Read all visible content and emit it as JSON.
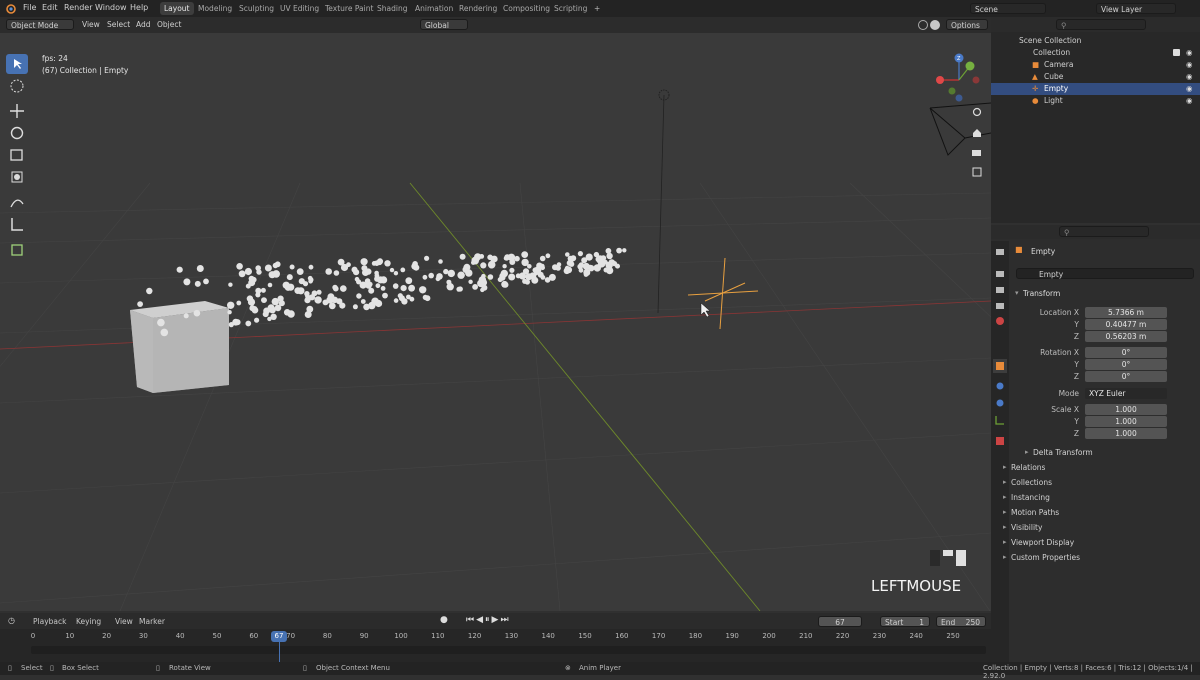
{
  "menu": [
    "File",
    "Edit",
    "Render",
    "Window",
    "Help"
  ],
  "workspaces": [
    "Layout",
    "Modeling",
    "Sculpting",
    "UV Editing",
    "Texture Paint",
    "Shading",
    "Animation",
    "Rendering",
    "Compositing",
    "Scripting"
  ],
  "active_workspace": "Layout",
  "scene_name": "Scene",
  "view_layer": "View Layer",
  "viewport_header": {
    "mode": "Object Mode",
    "items": [
      "View",
      "Select",
      "Add",
      "Object"
    ],
    "orientation": "Global",
    "options": "Options"
  },
  "viewport_info": {
    "fps": "fps: 24",
    "collection": "(67) Collection | Empty"
  },
  "keystroke": "LEFTMOUSE",
  "outliner": {
    "rows": [
      {
        "label": "Scene Collection",
        "indent": 0
      },
      {
        "label": "Collection",
        "indent": 1
      },
      {
        "label": "Camera",
        "indent": 2
      },
      {
        "label": "Cube",
        "indent": 2
      },
      {
        "label": "Empty",
        "indent": 2
      },
      {
        "label": "Light",
        "indent": 2
      }
    ],
    "selected": "Empty"
  },
  "properties": {
    "object_name": "Empty",
    "data_name": "Empty",
    "transform_title": "Transform",
    "location_label": "Location X",
    "location": [
      "5.7366 m",
      "0.40477 m",
      "0.56203 m"
    ],
    "rotation_label": "Rotation X",
    "rotation": [
      "0°",
      "0°",
      "0°"
    ],
    "mode_label": "Mode",
    "mode": "XYZ Euler",
    "scale_label": "Scale X",
    "scale": [
      "1.000",
      "1.000",
      "1.000"
    ],
    "axis_y": "Y",
    "axis_z": "Z",
    "delta": "Delta Transform",
    "sections": [
      "Relations",
      "Collections",
      "Instancing",
      "Motion Paths",
      "Visibility",
      "Viewport Display",
      "Custom Properties"
    ]
  },
  "timeline": {
    "menu": [
      "Playback",
      "Keying",
      "View",
      "Marker"
    ],
    "current_frame": "67",
    "start_label": "Start",
    "start": "1",
    "end_label": "End",
    "end": "250",
    "ticks": [
      "0",
      "10",
      "20",
      "30",
      "40",
      "50",
      "60",
      "70",
      "80",
      "90",
      "100",
      "110",
      "120",
      "130",
      "140",
      "150",
      "160",
      "170",
      "180",
      "190",
      "200",
      "210",
      "220",
      "230",
      "240",
      "250"
    ]
  },
  "statusbar": {
    "select": "Select",
    "box_select": "Box Select",
    "rotate_view": "Rotate View",
    "context_menu": "Object Context Menu",
    "anim_player": "Anim Player",
    "stats": "Collection | Empty | Verts:8 | Faces:6 | Tris:12 | Objects:1/4 | 2.92.0"
  },
  "colors": {
    "accent": "#4772b3",
    "selection": "#334d80",
    "empty_orange": "#e8a040"
  }
}
